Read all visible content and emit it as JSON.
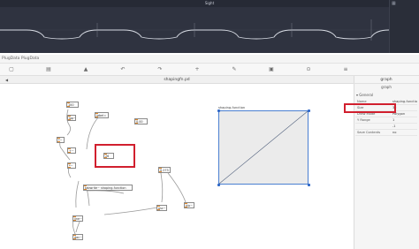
{
  "waveform_window": {
    "title": "Sight",
    "side_icon": "grid-icon"
  },
  "plugdata": {
    "window_title": "PlugData  PlugData",
    "toolbar_icons": [
      "new-file-icon",
      "open-file-icon",
      "save-icon",
      "undo-icon",
      "redo-icon",
      "add-object-icon",
      "edit-mode-icon",
      "lock-icon",
      "zoom-icon",
      "sidebar-toggle-icon"
    ],
    "tab": {
      "arrow": "◀",
      "label": "shapingfn.pd"
    }
  },
  "patch": {
    "objects": [
      "100",
      "label=",
      "0.00",
      "26",
      "0.273",
      "tabwrite~ shaping-function",
      "dac~",
      "*~",
      "+~",
      "*~",
      "osc~",
      "lop~",
      "hip~",
      "line~"
    ],
    "graph_label": "shaping-function"
  },
  "inspector": {
    "header": "graph",
    "object_name": "graph",
    "section": "General",
    "properties": [
      {
        "key": "Name",
        "value": "shaping-function"
      },
      {
        "key": "Size",
        "value": "32"
      },
      {
        "key": "Draw Mode",
        "value": "Polygon"
      },
      {
        "key": "Y Range",
        "value": "1"
      },
      {
        "key": "",
        "value": "-1"
      },
      {
        "key": "Save Contents",
        "value": "no"
      }
    ]
  },
  "colors": {
    "accent": "#4a7fd1",
    "highlight": "#d11f2e",
    "inlet": "#e08a2e"
  }
}
